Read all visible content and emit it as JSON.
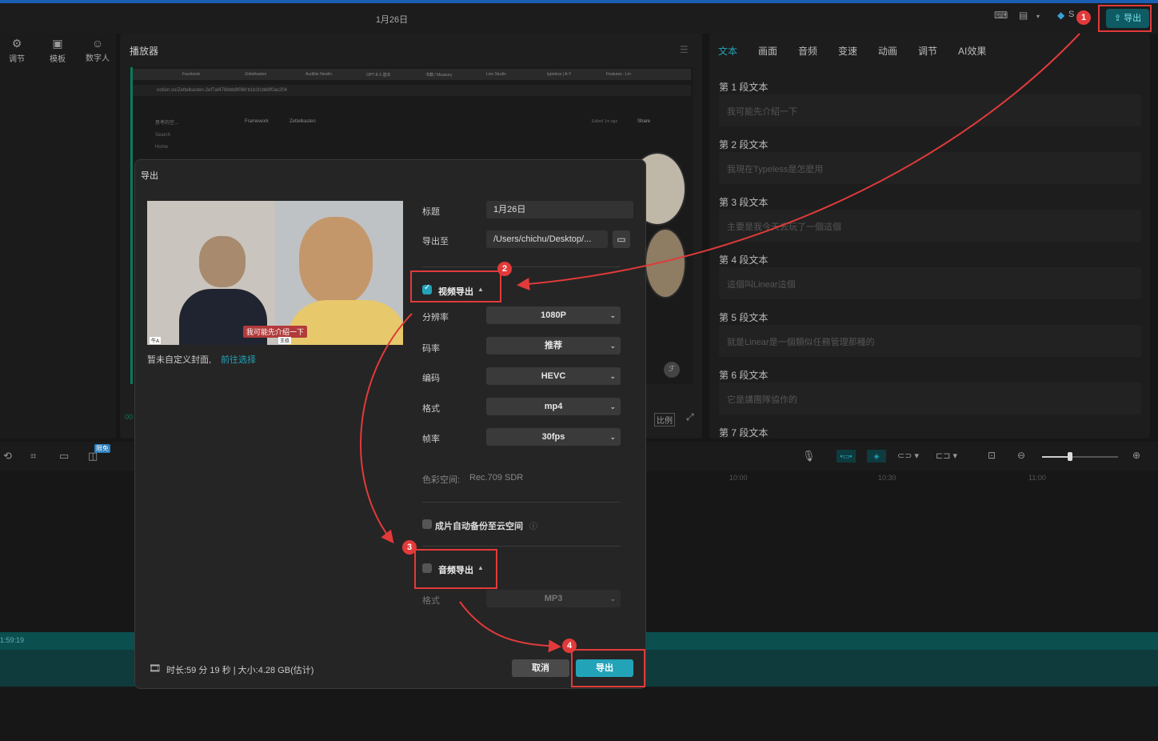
{
  "window": {
    "title": "1月26日"
  },
  "topbar": {
    "export_label": "导出",
    "user_initial": "S"
  },
  "left_panel": {
    "items": [
      {
        "label": "调节",
        "icon": "sliders-icon"
      },
      {
        "label": "模板",
        "icon": "template-icon"
      },
      {
        "label": "数字人",
        "icon": "avatar-icon"
      }
    ]
  },
  "player": {
    "title": "播放器",
    "ratio_label": "比例",
    "time_prefix": "00"
  },
  "browser_tabs": [
    "Facebook",
    "Zettelkasten",
    "Audible Newlin",
    "OPT-8-1-基本",
    "书籍 / Measury",
    "Live Studio",
    "typeless | A-Y",
    "Features - Lin"
  ],
  "browser_url": "notion.so/Zettelkasten-2ef7af478bbb8f06b'b1b1fcbb8f0ac204",
  "browser_page": {
    "breadcrumb_a": "Framework",
    "breadcrumb_b": "Zettelkasten",
    "sidebar_a": "思考的空...",
    "sidebar_search": "Search",
    "sidebar_home": "Home",
    "share": "Share",
    "edited": "Edited 1m ago"
  },
  "right_panel": {
    "tabs": [
      "文本",
      "画面",
      "音频",
      "变速",
      "动画",
      "调节",
      "AI效果"
    ],
    "active_tab": 0,
    "segments": [
      {
        "heading": "第 1 段文本",
        "text": "我可能先介紹一下"
      },
      {
        "heading": "第 2 段文本",
        "text": "我現在Typeless是怎麼用"
      },
      {
        "heading": "第 3 段文本",
        "text": "主要是我今天去玩了一個這個"
      },
      {
        "heading": "第 4 段文本",
        "text": "這個叫Linear這個"
      },
      {
        "heading": "第 5 段文本",
        "text": "就是Linear是一個類似任務管理那種的"
      },
      {
        "heading": "第 6 段文本",
        "text": "它是講團隊協作的"
      },
      {
        "heading": "第 7 段文本",
        "text": ""
      }
    ]
  },
  "toolbar": {
    "limited_free": "限免"
  },
  "timeline": {
    "ticks": [
      "10:00",
      "10:30",
      "11:00"
    ],
    "track_time": "1:59:19"
  },
  "dialog": {
    "title": "导出",
    "cover_note": "暂未自定义封面,",
    "cover_link": "前往选择",
    "subtitle_in_preview": "我可能先介绍一下",
    "name_tag_left": "牛A",
    "name_tag_right": "王玖",
    "fields": {
      "title_label": "标题",
      "title_value": "1月26日",
      "path_label": "导出至",
      "path_value": "/Users/chichu/Desktop/..."
    },
    "video_export": {
      "label": "视频导出",
      "checked": true,
      "options": [
        {
          "label": "分辨率",
          "value": "1080P"
        },
        {
          "label": "码率",
          "value": "推荐"
        },
        {
          "label": "编码",
          "value": "HEVC"
        },
        {
          "label": "格式",
          "value": "mp4"
        },
        {
          "label": "帧率",
          "value": "30fps"
        }
      ],
      "color_space_label": "色彩空间:",
      "color_space_value": "Rec.709 SDR"
    },
    "cloud_backup": {
      "label": "成片自动备份至云空间",
      "checked": false
    },
    "audio_export": {
      "label": "音频导出",
      "checked": false,
      "format_label": "格式",
      "format_value": "MP3"
    },
    "footer": {
      "info": "时长:59 分 19 秒 | 大小:4.28 GB(估计)",
      "cancel_label": "取消",
      "export_label": "导出"
    }
  },
  "annotations": {
    "badges": [
      "1",
      "2",
      "3",
      "4"
    ],
    "color": "#e23a3a"
  }
}
